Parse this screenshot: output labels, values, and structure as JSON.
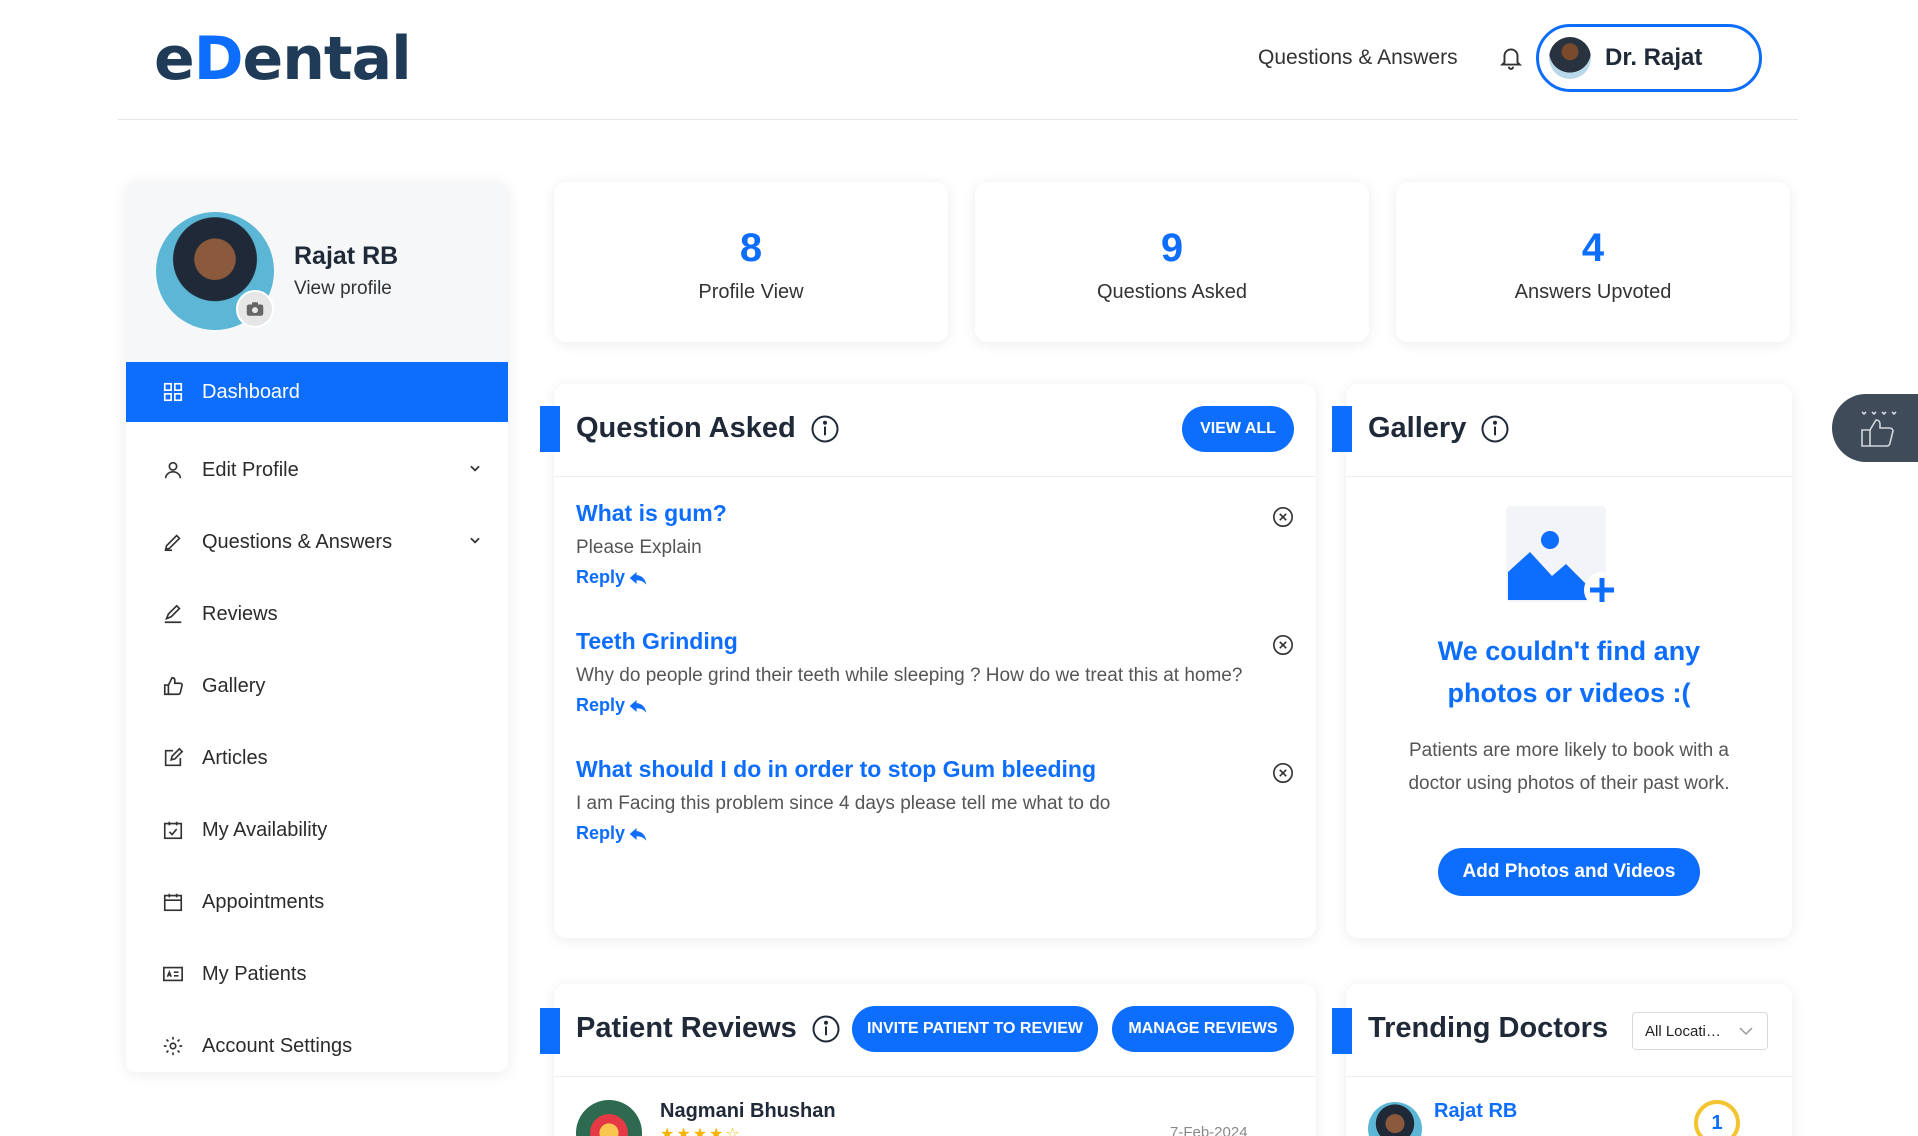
{
  "header": {
    "logo_prefix": "e",
    "logo_tooth": "D",
    "logo_suffix": "ental",
    "nav_link": "Questions & Answers",
    "user_name": "Dr. Rajat",
    "bell_icon": "bell-icon"
  },
  "sidebar": {
    "profile_name": "Rajat RB",
    "view_profile": "View profile",
    "camera_icon": "camera-icon",
    "items": [
      {
        "label": "Dashboard",
        "icon": "grid-icon",
        "active": true
      },
      {
        "label": "Edit Profile",
        "icon": "user-icon",
        "chevron": true
      },
      {
        "label": "Questions & Answers",
        "icon": "pen-icon",
        "chevron": true
      },
      {
        "label": "Reviews",
        "icon": "edit-icon"
      },
      {
        "label": "Gallery",
        "icon": "thumbs-up-icon"
      },
      {
        "label": "Articles",
        "icon": "edit-square-icon"
      },
      {
        "label": "My Availability",
        "icon": "calendar-check-icon"
      },
      {
        "label": "Appointments",
        "icon": "calendar-icon"
      },
      {
        "label": "My Patients",
        "icon": "id-card-icon"
      },
      {
        "label": "Account Settings",
        "icon": "gear-icon"
      }
    ]
  },
  "stats": [
    {
      "value": "8",
      "label": "Profile View"
    },
    {
      "value": "9",
      "label": "Questions Asked"
    },
    {
      "value": "4",
      "label": "Answers Upvoted"
    }
  ],
  "questions": {
    "title": "Question Asked",
    "view_all": "VIEW ALL",
    "items": [
      {
        "title": "What is gum?",
        "desc": "Please Explain",
        "reply": "Reply"
      },
      {
        "title": "Teeth Grinding",
        "desc": "Why do people grind their teeth while sleeping ? How do we treat this at home?",
        "reply": "Reply"
      },
      {
        "title": "What should I do in order to stop Gum bleeding",
        "desc": "I am Facing this problem since 4 days please tell me what to do",
        "reply": "Reply"
      }
    ]
  },
  "gallery": {
    "title": "Gallery",
    "empty_title_line1": "We couldn't find any",
    "empty_title_line2": "photos or videos :(",
    "empty_text": "Patients are more likely to book with a doctor using photos of their past work.",
    "button": "Add Photos and Videos"
  },
  "reviews": {
    "title": "Patient Reviews",
    "invite_button": "INVITE PATIENT TO REVIEW",
    "manage_button": "MANAGE REVIEWS",
    "first_reviewer": "Nagmani Bhushan",
    "first_stars": "★★★★☆",
    "first_date": "7-Feb-2024"
  },
  "trending": {
    "title": "Trending Doctors",
    "location_select": "All Locations",
    "first_doctor": "Rajat RB",
    "first_rank": "1"
  },
  "colors": {
    "accent": "#0d6efd",
    "dark": "#1f2937"
  }
}
